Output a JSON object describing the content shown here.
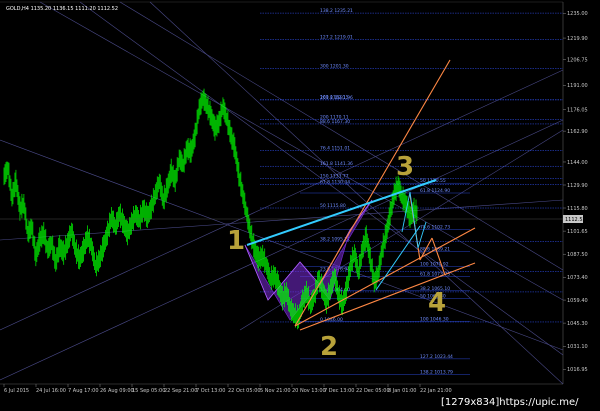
{
  "window": {
    "symbol_line": "GOLD,H4 1135.20 1136.15 1111.20 1112.52",
    "watermark": "[1279x834]https://upic.me/"
  },
  "colors": {
    "background": "#000000",
    "candles": "#00ff00",
    "fibo": "#3355ff",
    "trend": "#4a4a88",
    "wave_lines": "#ff8844",
    "cyan": "#33ccff",
    "harmonic": "#7a2bd6",
    "wave_labels": "#b8a23a",
    "current_price_box": "#c8c8c8"
  },
  "chart_data": {
    "type": "candlestick",
    "instrument": "GOLD",
    "timeframe": "H4",
    "ylim": [
      1008,
      1242
    ],
    "price_axis_ticks": [
      "1235.00",
      "1219.90",
      "1206.75",
      "1191.00",
      "1176.05",
      "1162.90",
      "1144.00",
      "1129.90",
      "1115.80",
      "1101.65",
      "1087.50",
      "1073.40",
      "1059.40",
      "1045.30",
      "1031.10",
      "1016.95"
    ],
    "current_price": "1112.52",
    "time_axis_labels": [
      "6 Jul 2015",
      "24 Jul 16:00",
      "7 Aug 17:00",
      "26 Aug 09:00",
      "15 Sep 05:00",
      "22 Sep 21:00",
      "7 Oct 13:00",
      "22 Oct 05:00",
      "5 Nov 21:00",
      "20 Nov 13:00",
      "7 Dec 13:00",
      "22 Dec 05:00",
      "8 Jan 01:00",
      "22 Jan 21:00"
    ],
    "price_path": [
      [
        0,
        1135
      ],
      [
        2,
        1140
      ],
      [
        4,
        1122
      ],
      [
        6,
        1132
      ],
      [
        8,
        1115
      ],
      [
        10,
        1118
      ],
      [
        12,
        1100
      ],
      [
        14,
        1104
      ],
      [
        16,
        1086
      ],
      [
        18,
        1096
      ],
      [
        20,
        1100
      ],
      [
        22,
        1090
      ],
      [
        24,
        1094
      ],
      [
        26,
        1082
      ],
      [
        28,
        1092
      ],
      [
        30,
        1088
      ],
      [
        32,
        1094
      ],
      [
        34,
        1102
      ],
      [
        36,
        1090
      ],
      [
        38,
        1084
      ],
      [
        40,
        1090
      ],
      [
        42,
        1098
      ],
      [
        44,
        1092
      ],
      [
        46,
        1080
      ],
      [
        48,
        1084
      ],
      [
        50,
        1092
      ],
      [
        52,
        1100
      ],
      [
        54,
        1110
      ],
      [
        56,
        1104
      ],
      [
        58,
        1112
      ],
      [
        60,
        1106
      ],
      [
        62,
        1100
      ],
      [
        64,
        1106
      ],
      [
        66,
        1112
      ],
      [
        68,
        1108
      ],
      [
        70,
        1115
      ],
      [
        72,
        1110
      ],
      [
        74,
        1116
      ],
      [
        76,
        1124
      ],
      [
        78,
        1132
      ],
      [
        80,
        1120
      ],
      [
        82,
        1128
      ],
      [
        84,
        1138
      ],
      [
        86,
        1132
      ],
      [
        88,
        1146
      ],
      [
        90,
        1142
      ],
      [
        92,
        1152
      ],
      [
        94,
        1150
      ],
      [
        96,
        1160
      ],
      [
        98,
        1176
      ],
      [
        100,
        1183
      ],
      [
        102,
        1178
      ],
      [
        104,
        1172
      ],
      [
        106,
        1164
      ],
      [
        108,
        1168
      ],
      [
        110,
        1178
      ],
      [
        112,
        1170
      ],
      [
        114,
        1160
      ],
      [
        116,
        1152
      ],
      [
        118,
        1136
      ],
      [
        120,
        1124
      ],
      [
        122,
        1112
      ],
      [
        124,
        1100
      ],
      [
        126,
        1090
      ],
      [
        128,
        1084
      ],
      [
        130,
        1086
      ],
      [
        132,
        1080
      ],
      [
        134,
        1072
      ],
      [
        136,
        1074
      ],
      [
        138,
        1068
      ],
      [
        140,
        1060
      ],
      [
        142,
        1064
      ],
      [
        144,
        1054
      ],
      [
        146,
        1050
      ],
      [
        148,
        1048
      ],
      [
        150,
        1058
      ],
      [
        152,
        1064
      ],
      [
        154,
        1056
      ],
      [
        156,
        1062
      ],
      [
        158,
        1072
      ],
      [
        160,
        1066
      ],
      [
        162,
        1058
      ],
      [
        164,
        1066
      ],
      [
        166,
        1074
      ],
      [
        168,
        1062
      ],
      [
        170,
        1056
      ],
      [
        172,
        1066
      ],
      [
        174,
        1080
      ],
      [
        176,
        1088
      ],
      [
        178,
        1076
      ],
      [
        180,
        1090
      ],
      [
        182,
        1098
      ],
      [
        184,
        1084
      ],
      [
        186,
        1070
      ],
      [
        188,
        1076
      ],
      [
        190,
        1090
      ],
      [
        192,
        1100
      ],
      [
        194,
        1112
      ],
      [
        196,
        1124
      ],
      [
        198,
        1130
      ],
      [
        200,
        1122
      ],
      [
        202,
        1118
      ],
      [
        204,
        1110
      ],
      [
        206,
        1114
      ],
      [
        208,
        1112
      ]
    ],
    "fibo_levels_upper": [
      {
        "label": "138.2 1235.21",
        "price": 1235.2
      },
      {
        "label": "127.2 1219.01",
        "price": 1219.0
      },
      {
        "label": "300 1201.30",
        "price": 1201.3
      },
      {
        "label": "261.8 1181.96",
        "price": 1182.0
      },
      {
        "label": "100 1182.15",
        "price": 1182.15
      },
      {
        "label": "200 1170.11",
        "price": 1170.1
      },
      {
        "label": "88.6 1167.30",
        "price": 1167.3
      },
      {
        "label": "76.4 1151.01",
        "price": 1151.0
      },
      {
        "label": "161.8 1141.36",
        "price": 1141.4
      },
      {
        "label": "150 1133.77",
        "price": 1133.8
      },
      {
        "label": "61.8 1130.34",
        "price": 1130.3
      },
      {
        "label": "50 1115.80",
        "price": 1115.8
      },
      {
        "label": "38.2 1095.21",
        "price": 1095.2
      },
      {
        "label": "23.6 1076.98",
        "price": 1077.0
      },
      {
        "label": "11.8 1064.40",
        "price": 1064.4
      },
      {
        "label": "0 1046.00",
        "price": 1046.0
      }
    ],
    "fibo_levels_inner": [
      {
        "label": "50 1130.55",
        "price": 1131.0
      },
      {
        "label": "61.8 1124.90",
        "price": 1125.0
      },
      {
        "label": "78.6 1102.73",
        "price": 1102.7
      },
      {
        "label": "88.6 1089.21",
        "price": 1089.2
      },
      {
        "label": "100 1079.92",
        "price": 1079.9
      },
      {
        "label": "61.8 1073.73",
        "price": 1073.7
      },
      {
        "label": "38.2 1065.10",
        "price": 1065.1
      },
      {
        "label": "50 1060.30",
        "price": 1060.3
      },
      {
        "label": "100 1046.30",
        "price": 1046.3
      },
      {
        "label": "127.2 1023.44",
        "price": 1023.4
      },
      {
        "label": "138.2 1013.79",
        "price": 1013.8
      }
    ],
    "wave_labels": [
      "1",
      "2",
      "3",
      "4"
    ]
  }
}
